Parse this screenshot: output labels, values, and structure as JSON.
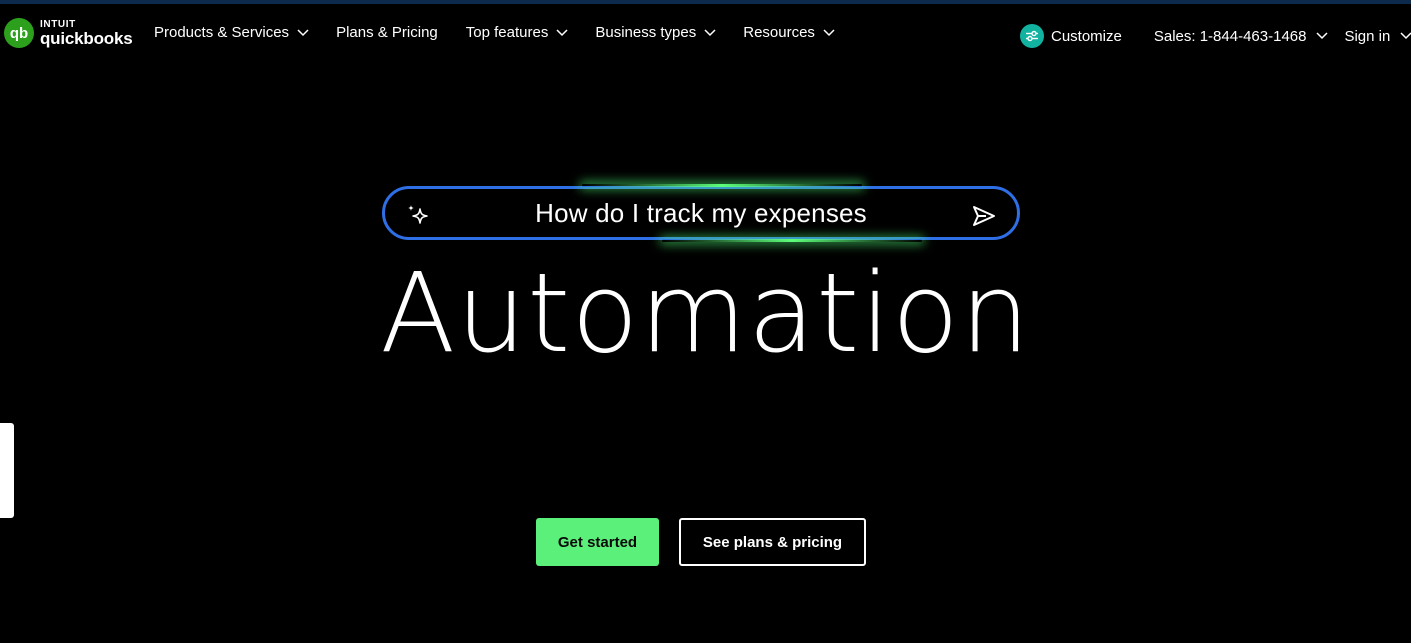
{
  "header": {
    "logo_top": "INTUIT",
    "logo_bottom": "quickbooks",
    "nav": [
      {
        "label": "Products & Services",
        "has_dropdown": true
      },
      {
        "label": "Plans & Pricing",
        "has_dropdown": false
      },
      {
        "label": "Top features",
        "has_dropdown": true
      },
      {
        "label": "Business types",
        "has_dropdown": true
      },
      {
        "label": "Resources",
        "has_dropdown": true
      }
    ],
    "customize_label": "Customize",
    "sales_label": "Sales: 1-844-463-1468",
    "signin_label": "Sign in"
  },
  "search": {
    "query": "How do I track my expenses",
    "left_icon": "sparkle-icon",
    "right_icon": "send-icon"
  },
  "hero": {
    "headline": "Automation"
  },
  "cta": {
    "primary_label": "Get started",
    "secondary_label": "See plans & pricing"
  },
  "colors": {
    "background": "#000000",
    "brand_green": "#2ca01c",
    "cta_green": "#5bf07a",
    "search_border": "#2f6fe6",
    "glow_green": "#5dff7a",
    "customize_teal": "#12b2a1"
  }
}
